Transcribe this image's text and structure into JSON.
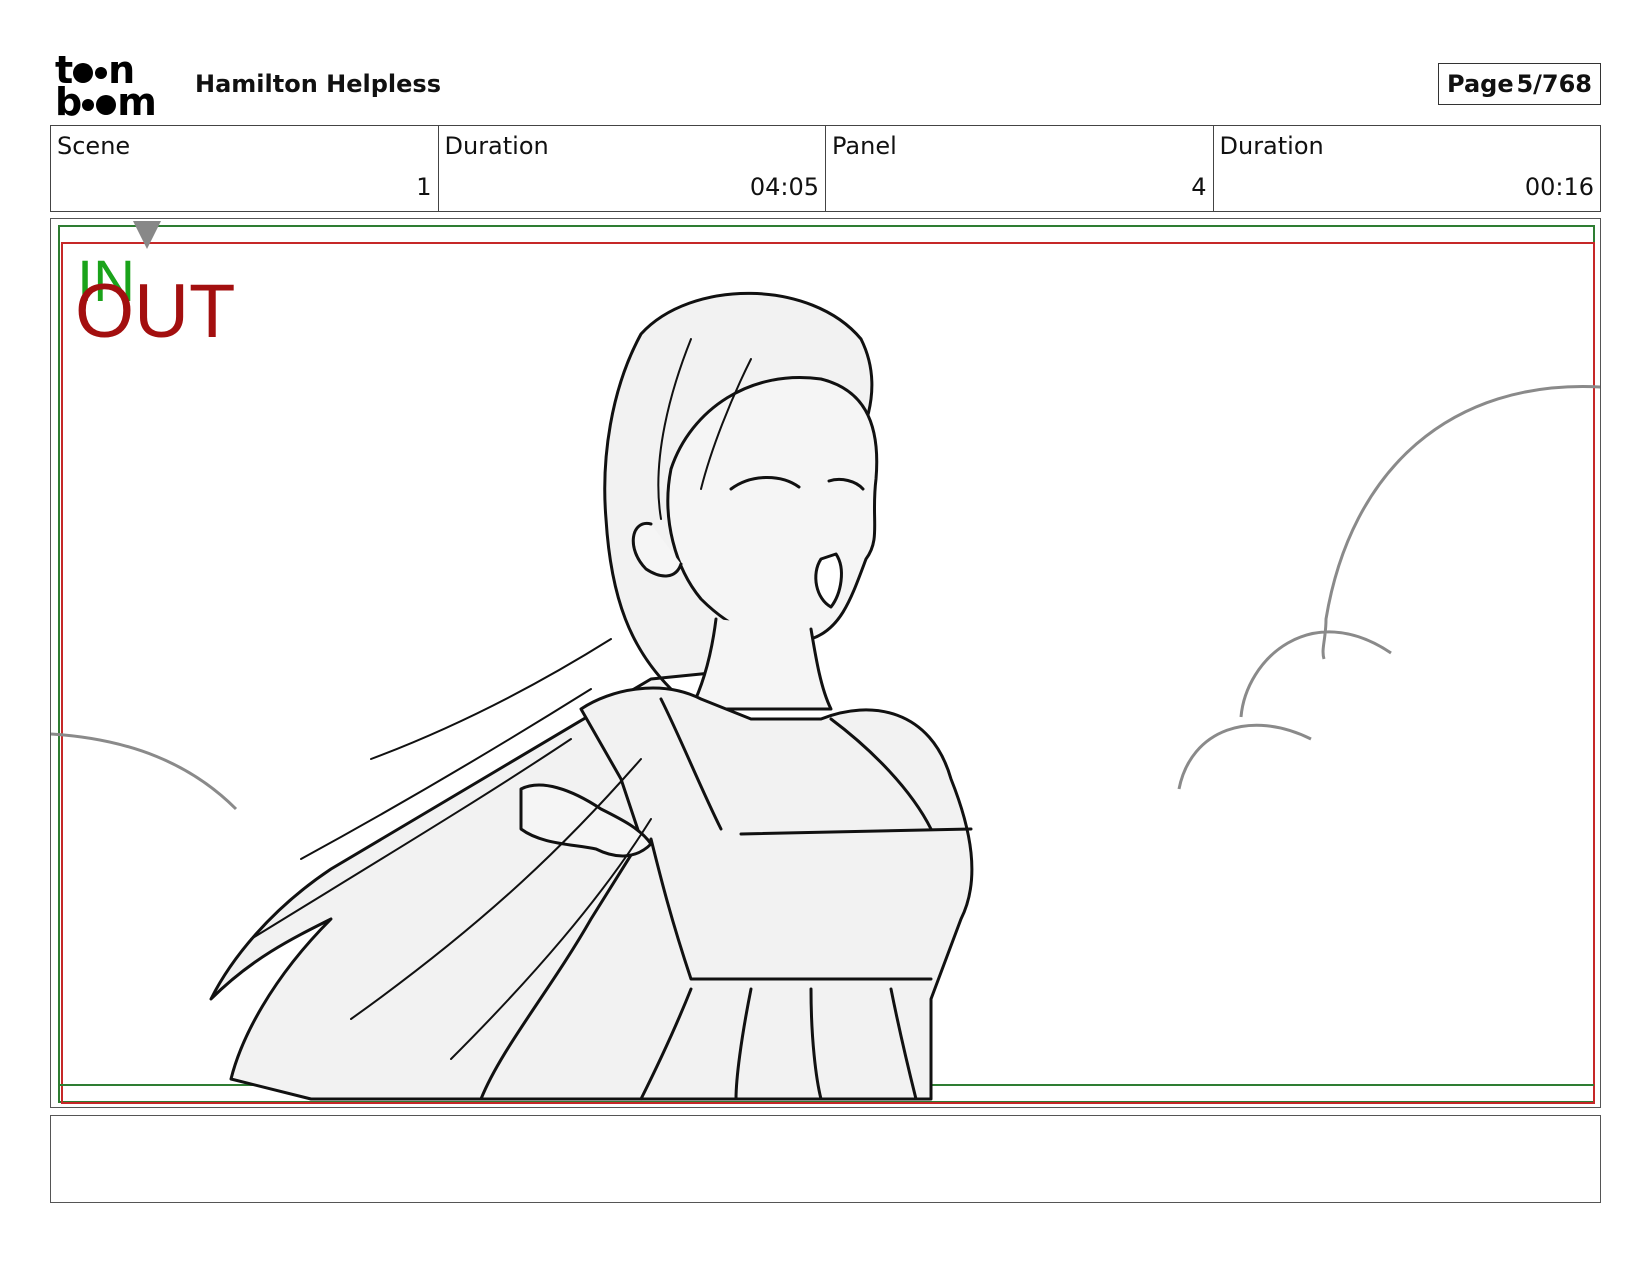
{
  "header": {
    "logo_top": "toon",
    "logo_bottom": "boom",
    "project_title": "Hamilton Helpless",
    "page_label": "Page",
    "page_value": "5/768"
  },
  "info": {
    "scene_label": "Scene",
    "scene_value": "1",
    "scene_duration_label": "Duration",
    "scene_duration_value": "04:05",
    "panel_label": "Panel",
    "panel_value": "4",
    "panel_duration_label": "Duration",
    "panel_duration_value": "00:16"
  },
  "panel": {
    "in_marker": "IN",
    "out_marker": "OUT",
    "colors": {
      "in": "#1aa31a",
      "out": "#a30f0f",
      "safe_green": "#2e7d32",
      "safe_red": "#c62828",
      "sketch": "#111111",
      "cloud": "#8a8a8a",
      "fill": "#f2f2f2"
    }
  },
  "notes": {
    "text": ""
  }
}
